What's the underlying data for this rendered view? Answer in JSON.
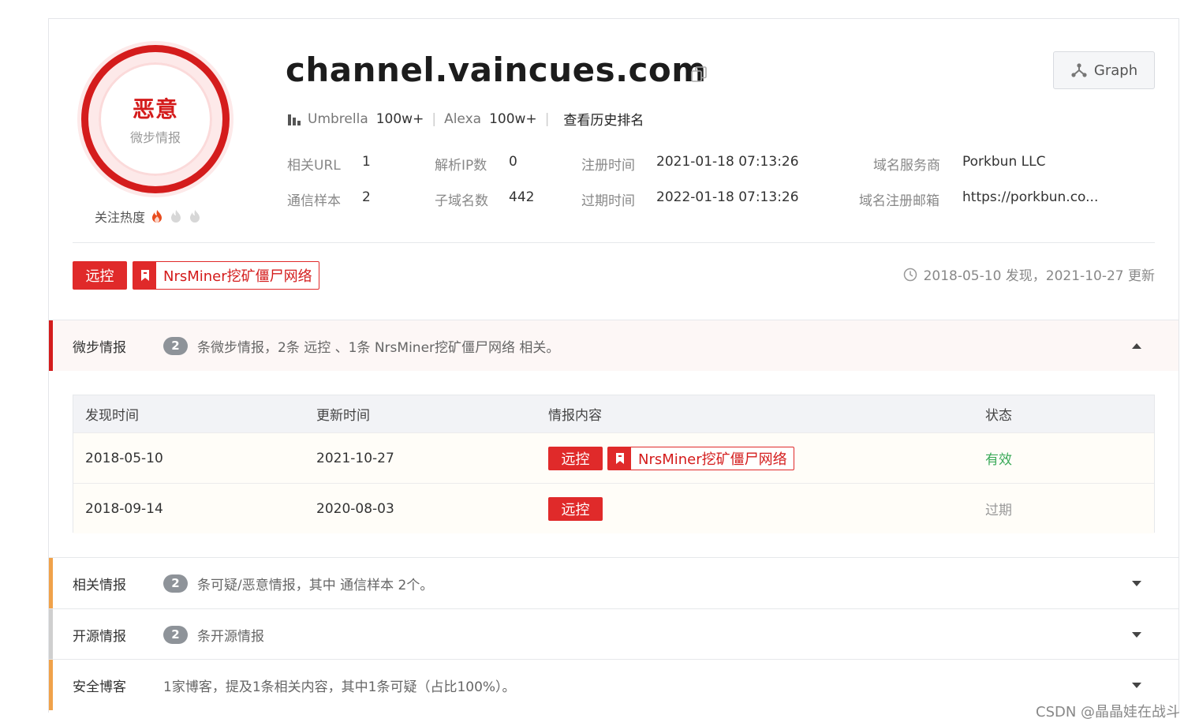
{
  "domain": "channel.vaincues.com",
  "verdict": {
    "label": "恶意",
    "source": "微步情报"
  },
  "heat": {
    "label": "关注热度",
    "level": 1,
    "max": 3
  },
  "graph_button": "Graph",
  "ranking": {
    "umbrella_label": "Umbrella",
    "umbrella_value": "100w+",
    "alexa_label": "Alexa",
    "alexa_value": "100w+",
    "history_link": "查看历史排名"
  },
  "info": {
    "related_url_label": "相关URL",
    "related_url_value": "1",
    "comm_sample_label": "通信样本",
    "comm_sample_value": "2",
    "resolve_ip_label": "解析IP数",
    "resolve_ip_value": "0",
    "subdomain_label": "子域名数",
    "subdomain_value": "442",
    "reg_time_label": "注册时间",
    "reg_time_value": "2021-01-18 07:13:26",
    "exp_time_label": "过期时间",
    "exp_time_value": "2022-01-18 07:13:26",
    "registrar_label": "域名服务商",
    "registrar_value": "Porkbun LLC",
    "reg_email_label": "域名注册邮箱",
    "reg_email_value": "https://porkbun.co..."
  },
  "tags": {
    "remote_control": "远控",
    "botnet": "NrsMiner挖矿僵尸网络"
  },
  "timeline": "2018-05-10 发现，2021-10-27 更新",
  "sections": [
    {
      "title": "微步情报",
      "count": "2",
      "desc": "条微步情报，2条 远控 、1条 NrsMiner挖矿僵尸网络 相关。"
    },
    {
      "title": "相关情报",
      "count": "2",
      "desc": "条可疑/恶意情报，其中 通信样本 2个。"
    },
    {
      "title": "开源情报",
      "count": "2",
      "desc": "条开源情报"
    },
    {
      "title": "安全博客",
      "desc": "1家博客，提及1条相关内容，其中1条可疑（占比100%）。"
    }
  ],
  "table": {
    "headers": [
      "发现时间",
      "更新时间",
      "情报内容",
      "状态"
    ],
    "rows": [
      {
        "found": "2018-05-10",
        "updated": "2021-10-27",
        "tag1": "远控",
        "tag2": "NrsMiner挖矿僵尸网络",
        "status": "有效"
      },
      {
        "found": "2018-09-14",
        "updated": "2020-08-03",
        "tag1": "远控",
        "status": "过期"
      }
    ]
  },
  "colors": {
    "malicious": "#d41c1c",
    "valid": "#3caa5a",
    "expired": "#999999",
    "warn_bar": "#f0a24a"
  },
  "watermark": "CSDN @晶晶娃在战斗"
}
